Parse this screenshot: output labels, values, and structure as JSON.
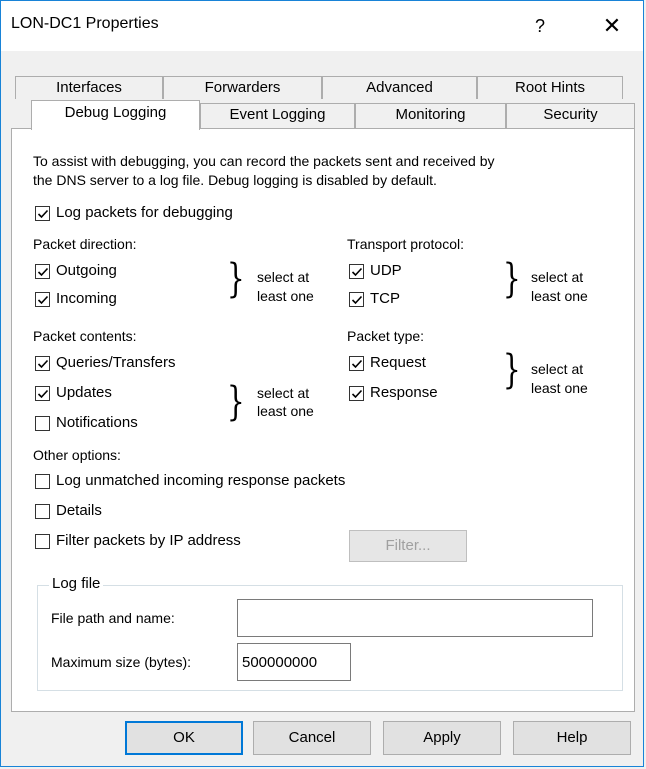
{
  "window": {
    "title": "LON-DC1 Properties",
    "help": "?",
    "close": "✕"
  },
  "tabs": {
    "row1": [
      "Interfaces",
      "Forwarders",
      "Advanced",
      "Root Hints"
    ],
    "row2": [
      "Debug Logging",
      "Event Logging",
      "Monitoring",
      "Security"
    ],
    "selected": "Debug Logging"
  },
  "content": {
    "intro_line1": "To assist with debugging, you can record the packets sent and received by",
    "intro_line2": "the DNS server to a log file. Debug logging is disabled by default.",
    "log_packets": {
      "label": "Log packets for debugging",
      "checked": true
    },
    "packet_direction": {
      "label": "Packet direction:",
      "outgoing": {
        "label": "Outgoing",
        "checked": true
      },
      "incoming": {
        "label": "Incoming",
        "checked": true
      },
      "hint1": "select at",
      "hint2": "least one"
    },
    "transport_protocol": {
      "label": "Transport protocol:",
      "udp": {
        "label": "UDP",
        "checked": true
      },
      "tcp": {
        "label": "TCP",
        "checked": true
      },
      "hint1": "select at",
      "hint2": "least one"
    },
    "packet_contents": {
      "label": "Packet contents:",
      "queries": {
        "label": "Queries/Transfers",
        "checked": true
      },
      "updates": {
        "label": "Updates",
        "checked": true
      },
      "notifications": {
        "label": "Notifications",
        "checked": false
      },
      "hint1": "select at",
      "hint2": "least one"
    },
    "packet_type": {
      "label": "Packet type:",
      "request": {
        "label": "Request",
        "checked": true
      },
      "response": {
        "label": "Response",
        "checked": true
      },
      "hint1": "select at",
      "hint2": "least one"
    },
    "other_options": {
      "label": "Other options:",
      "unmatched": {
        "label": "Log unmatched incoming response packets",
        "checked": false
      },
      "details": {
        "label": "Details",
        "checked": false
      },
      "filter_ip": {
        "label": "Filter packets by IP address",
        "checked": false
      },
      "filter_button": "Filter..."
    },
    "log_file": {
      "legend": "Log file",
      "path_label": "File path and name:",
      "path_value": "",
      "max_size_label": "Maximum size (bytes):",
      "max_size_value": "500000000"
    }
  },
  "buttons": {
    "ok": "OK",
    "cancel": "Cancel",
    "apply": "Apply",
    "help": "Help"
  },
  "colors": {
    "accent": "#0078d7",
    "border": "#adadad",
    "dialog_bg": "#f0f0f0"
  }
}
